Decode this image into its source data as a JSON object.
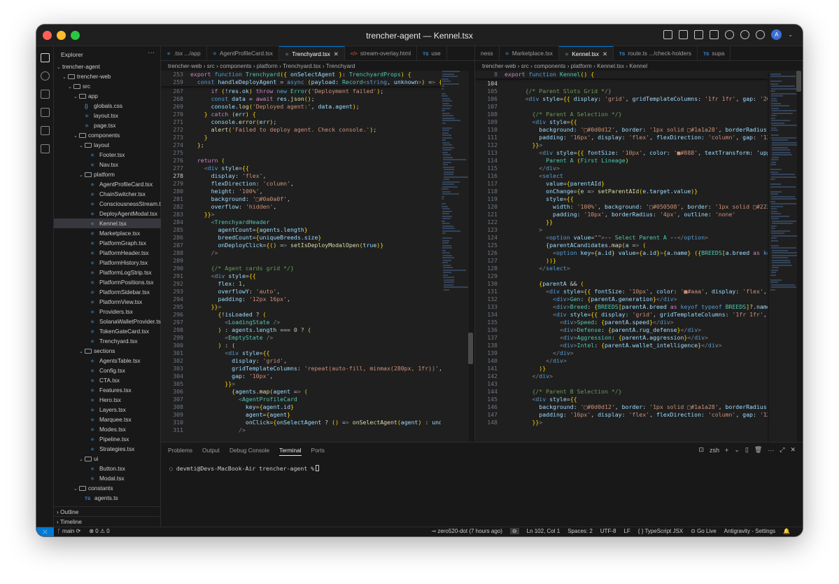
{
  "window": {
    "title": "trencher-agent — Kennel.tsx"
  },
  "explorer": {
    "header": "Explorer",
    "tree": [
      {
        "label": "trencher-agent",
        "depth": 0,
        "kind": "root"
      },
      {
        "label": "trencher-web",
        "depth": 1,
        "kind": "folder"
      },
      {
        "label": "src",
        "depth": 2,
        "kind": "folder"
      },
      {
        "label": "app",
        "depth": 3,
        "kind": "folder"
      },
      {
        "label": "globals.css",
        "depth": 4,
        "kind": "css"
      },
      {
        "label": "layout.tsx",
        "depth": 4,
        "kind": "tsx"
      },
      {
        "label": "page.tsx",
        "depth": 4,
        "kind": "tsx"
      },
      {
        "label": "components",
        "depth": 3,
        "kind": "folder"
      },
      {
        "label": "layout",
        "depth": 4,
        "kind": "folder"
      },
      {
        "label": "Footer.tsx",
        "depth": 5,
        "kind": "tsx"
      },
      {
        "label": "Nav.tsx",
        "depth": 5,
        "kind": "tsx"
      },
      {
        "label": "platform",
        "depth": 4,
        "kind": "folder"
      },
      {
        "label": "AgentProfileCard.tsx",
        "depth": 5,
        "kind": "tsx"
      },
      {
        "label": "ChainSwitcher.tsx",
        "depth": 5,
        "kind": "tsx"
      },
      {
        "label": "ConsciousnessStream.tsx",
        "depth": 5,
        "kind": "tsx"
      },
      {
        "label": "DeployAgentModal.tsx",
        "depth": 5,
        "kind": "tsx"
      },
      {
        "label": "Kennel.tsx",
        "depth": 5,
        "kind": "tsx",
        "selected": true
      },
      {
        "label": "Marketplace.tsx",
        "depth": 5,
        "kind": "tsx"
      },
      {
        "label": "PlatformGraph.tsx",
        "depth": 5,
        "kind": "tsx"
      },
      {
        "label": "PlatformHeader.tsx",
        "depth": 5,
        "kind": "tsx"
      },
      {
        "label": "PlatformHistory.tsx",
        "depth": 5,
        "kind": "tsx"
      },
      {
        "label": "PlatformLogStrip.tsx",
        "depth": 5,
        "kind": "tsx"
      },
      {
        "label": "PlatformPositions.tsx",
        "depth": 5,
        "kind": "tsx"
      },
      {
        "label": "PlatformSidebar.tsx",
        "depth": 5,
        "kind": "tsx"
      },
      {
        "label": "PlatformView.tsx",
        "depth": 5,
        "kind": "tsx"
      },
      {
        "label": "Providers.tsx",
        "depth": 5,
        "kind": "tsx"
      },
      {
        "label": "SolanaWalletProvider.tsx",
        "depth": 5,
        "kind": "tsx"
      },
      {
        "label": "TokenGateCard.tsx",
        "depth": 5,
        "kind": "tsx"
      },
      {
        "label": "Trenchyard.tsx",
        "depth": 5,
        "kind": "tsx"
      },
      {
        "label": "sections",
        "depth": 4,
        "kind": "folder"
      },
      {
        "label": "AgentsTable.tsx",
        "depth": 5,
        "kind": "tsx"
      },
      {
        "label": "Config.tsx",
        "depth": 5,
        "kind": "tsx"
      },
      {
        "label": "CTA.tsx",
        "depth": 5,
        "kind": "tsx"
      },
      {
        "label": "Features.tsx",
        "depth": 5,
        "kind": "tsx"
      },
      {
        "label": "Hero.tsx",
        "depth": 5,
        "kind": "tsx"
      },
      {
        "label": "Layers.tsx",
        "depth": 5,
        "kind": "tsx"
      },
      {
        "label": "Marquee.tsx",
        "depth": 5,
        "kind": "tsx"
      },
      {
        "label": "Modes.tsx",
        "depth": 5,
        "kind": "tsx"
      },
      {
        "label": "Pipeline.tsx",
        "depth": 5,
        "kind": "tsx"
      },
      {
        "label": "Strategies.tsx",
        "depth": 5,
        "kind": "tsx"
      },
      {
        "label": "ui",
        "depth": 4,
        "kind": "folder"
      },
      {
        "label": "Button.tsx",
        "depth": 5,
        "kind": "tsx"
      },
      {
        "label": "Modal.tsx",
        "depth": 5,
        "kind": "tsx"
      },
      {
        "label": "constants",
        "depth": 3,
        "kind": "folder"
      },
      {
        "label": "agents.ts",
        "depth": 4,
        "kind": "ts"
      }
    ],
    "outline": "Outline",
    "timeline": "Timeline"
  },
  "left_editor": {
    "tabs": [
      {
        "label": ".tsx .../app",
        "kind": "tsx"
      },
      {
        "label": "AgentProfileCard.tsx",
        "kind": "tsx"
      },
      {
        "label": "Trenchyard.tsx",
        "kind": "tsx",
        "active": true
      },
      {
        "label": "stream-overlay.html",
        "kind": "html"
      },
      {
        "label": "use",
        "kind": "ts"
      }
    ],
    "breadcrumb": "trencher-web › src › components › platform › Trenchyard.tsx › Trenchyard",
    "sticky": [
      {
        "n": "253",
        "code": "export function Trenchyard({ onSelectAgent }: TrenchyardProps) {"
      },
      {
        "n": "259",
        "code": "  const handleDeployAgent = async (payload: Record<string, unknown>) => {"
      }
    ],
    "lines": [
      {
        "n": "267",
        "code": "      if (!res.ok) throw new Error('Deployment failed');"
      },
      {
        "n": "268",
        "code": "      const data = await res.json();"
      },
      {
        "n": "269",
        "code": "      console.log('Deployed agent:', data.agent);"
      },
      {
        "n": "270",
        "code": "    } catch (err) {"
      },
      {
        "n": "271",
        "code": "      console.error(err);"
      },
      {
        "n": "272",
        "code": "      alert('Failed to deploy agent. Check console.');"
      },
      {
        "n": "273",
        "code": "    }"
      },
      {
        "n": "274",
        "code": "  };"
      },
      {
        "n": "275",
        "code": ""
      },
      {
        "n": "276",
        "code": "  return ("
      },
      {
        "n": "277",
        "code": "    <div style={{"
      },
      {
        "n": "278",
        "code": "      display: 'flex',"
      },
      {
        "n": "279",
        "code": "      flexDirection: 'column',"
      },
      {
        "n": "280",
        "code": "      height: '100%',"
      },
      {
        "n": "281",
        "code": "      background: '□#0a0a0f',"
      },
      {
        "n": "282",
        "code": "      overflow: 'hidden',"
      },
      {
        "n": "283",
        "code": "    }}>"
      },
      {
        "n": "284",
        "code": "      <TrenchyardHeader"
      },
      {
        "n": "285",
        "code": "        agentCount={agents.length}"
      },
      {
        "n": "286",
        "code": "        breedCount={uniqueBreeds.size}"
      },
      {
        "n": "287",
        "code": "        onDeployClick={() => setIsDeployModalOpen(true)}"
      },
      {
        "n": "288",
        "code": "      />"
      },
      {
        "n": "289",
        "code": ""
      },
      {
        "n": "290",
        "code": "      {/* Agent cards grid */}"
      },
      {
        "n": "291",
        "code": "      <div style={{"
      },
      {
        "n": "292",
        "code": "        flex: 1,"
      },
      {
        "n": "293",
        "code": "        overflowY: 'auto',"
      },
      {
        "n": "294",
        "code": "        padding: '12px 16px',"
      },
      {
        "n": "295",
        "code": "      }}>"
      },
      {
        "n": "296",
        "code": "        {!isLoaded ? ("
      },
      {
        "n": "297",
        "code": "          <LoadingState />"
      },
      {
        "n": "298",
        "code": "        ) : agents.length === 0 ? ("
      },
      {
        "n": "299",
        "code": "          <EmptyState />"
      },
      {
        "n": "300",
        "code": "        ) : ("
      },
      {
        "n": "301",
        "code": "          <div style={{"
      },
      {
        "n": "302",
        "code": "            display: 'grid',"
      },
      {
        "n": "303",
        "code": "            gridTemplateColumns: 'repeat(auto-fill, minmax(280px, 1fr))',"
      },
      {
        "n": "304",
        "code": "            gap: '10px',"
      },
      {
        "n": "305",
        "code": "          }}>"
      },
      {
        "n": "306",
        "code": "            {agents.map(agent => ("
      },
      {
        "n": "307",
        "code": "              <AgentProfileCard"
      },
      {
        "n": "308",
        "code": "                key={agent.id}"
      },
      {
        "n": "309",
        "code": "                agent={agent}"
      },
      {
        "n": "310",
        "code": "                onClick={onSelectAgent ? () => onSelectAgent(agent) : undefin"
      },
      {
        "n": "311",
        "code": "              />"
      }
    ]
  },
  "right_editor": {
    "tabs": [
      {
        "label": "ness",
        "kind": "none"
      },
      {
        "label": "Marketplace.tsx",
        "kind": "tsx"
      },
      {
        "label": "Kennel.tsx",
        "kind": "tsx",
        "active": true
      },
      {
        "label": "route.ts .../check-holders",
        "kind": "ts"
      },
      {
        "label": "supa",
        "kind": "ts"
      }
    ],
    "breadcrumb": "trencher-web › src › components › platform › Kennel.tsx › Kennel",
    "sticky": [
      {
        "n": "8",
        "code": "export function Kennel() {"
      }
    ],
    "lines": [
      {
        "n": "104",
        "code": ""
      },
      {
        "n": "105",
        "code": "      {/* Parent Slots Grid */}"
      },
      {
        "n": "106",
        "code": "      <div style={{ display: 'grid', gridTemplateColumns: '1fr 1fr', gap: '20px'"
      },
      {
        "n": "107",
        "code": ""
      },
      {
        "n": "108",
        "code": "        {/* Parent A Selection */}"
      },
      {
        "n": "109",
        "code": "        <div style={{"
      },
      {
        "n": "110",
        "code": "          background: '□#0d0d12', border: '1px solid □#1a1a28', borderRadius:"
      },
      {
        "n": "111",
        "code": "          padding: '16px', display: 'flex', flexDirection: 'column', gap: '12px'"
      },
      {
        "n": "112",
        "code": "        }}>"
      },
      {
        "n": "113",
        "code": "          <div style={{ fontSize: '10px', color: '■#888', textTransform: 'upperc"
      },
      {
        "n": "114",
        "code": "            Parent A (First Lineage)"
      },
      {
        "n": "115",
        "code": "          </div>"
      },
      {
        "n": "116",
        "code": "          <select"
      },
      {
        "n": "117",
        "code": "            value={parentAId}"
      },
      {
        "n": "118",
        "code": "            onChange={e => setParentAId(e.target.value)}"
      },
      {
        "n": "119",
        "code": "            style={{"
      },
      {
        "n": "120",
        "code": "              width: '100%', background: '□#050508', border: '1px solid □#222'"
      },
      {
        "n": "121",
        "code": "              padding: '10px', borderRadius: '4px', outline: 'none'"
      },
      {
        "n": "122",
        "code": "            }}"
      },
      {
        "n": "123",
        "code": "          >"
      },
      {
        "n": "124",
        "code": "            <option value=\"\">-- Select Parent A --</option>"
      },
      {
        "n": "125",
        "code": "            {parentACandidates.map(a => ("
      },
      {
        "n": "126",
        "code": "              <option key={a.id} value={a.id}>{a.name} ({BREEDS[a.breed as keyof"
      },
      {
        "n": "127",
        "code": "            ))}"
      },
      {
        "n": "128",
        "code": "          </select>"
      },
      {
        "n": "129",
        "code": ""
      },
      {
        "n": "130",
        "code": "          {parentA && ("
      },
      {
        "n": "131",
        "code": "            <div style={{ fontSize: '10px', color: '■#aaa', display: 'flex', fle"
      },
      {
        "n": "132",
        "code": "              <div>Gen: {parentA.generation}</div>"
      },
      {
        "n": "133",
        "code": "              <div>Breed: {BREEDS[parentA.breed as keyof typeof BREEDS]?.name ||"
      },
      {
        "n": "134",
        "code": "              <div style={{ display: 'grid', gridTemplateColumns: '1fr 1fr', gap"
      },
      {
        "n": "135",
        "code": "                <div>Speed: {parentA.speed}</div>"
      },
      {
        "n": "136",
        "code": "                <div>Defense: {parentA.rug_defense}</div>"
      },
      {
        "n": "137",
        "code": "                <div>Aggression: {parentA.aggression}</div>"
      },
      {
        "n": "138",
        "code": "                <div>Intel: {parentA.wallet_intelligence}</div>"
      },
      {
        "n": "139",
        "code": "              </div>"
      },
      {
        "n": "140",
        "code": "            </div>"
      },
      {
        "n": "141",
        "code": "          )}"
      },
      {
        "n": "142",
        "code": "        </div>"
      },
      {
        "n": "143",
        "code": ""
      },
      {
        "n": "144",
        "code": "        {/* Parent B Selection */}"
      },
      {
        "n": "145",
        "code": "        <div style={{"
      },
      {
        "n": "146",
        "code": "          background: '□#0d0d12', border: '1px solid □#1a1a28', borderRadius:"
      },
      {
        "n": "147",
        "code": "          padding: '16px', display: 'flex', flexDirection: 'column', gap: '12px'"
      },
      {
        "n": "148",
        "code": "        }}>"
      }
    ]
  },
  "panel": {
    "tabs": [
      "Problems",
      "Output",
      "Debug Console",
      "Terminal",
      "Ports"
    ],
    "active_tab": "Terminal",
    "shell": "zsh",
    "prompt": "devmti@Devs-MacBook-Air trencher-agent %"
  },
  "status": {
    "branch": "main",
    "problems": "⊗ 0 ⚠ 0",
    "author": "zero520-dot (7 hours ago)",
    "position": "Ln 102, Col 1",
    "spaces": "Spaces: 2",
    "encoding": "UTF-8",
    "eol": "LF",
    "language": "{ } TypeScript JSX",
    "golive": "Go Live",
    "antigravity": "Antigravity - Settings"
  },
  "colors": {
    "accent": "#0078d4",
    "editor_bg": "#1f1f1f",
    "chrome_bg": "#181818"
  }
}
